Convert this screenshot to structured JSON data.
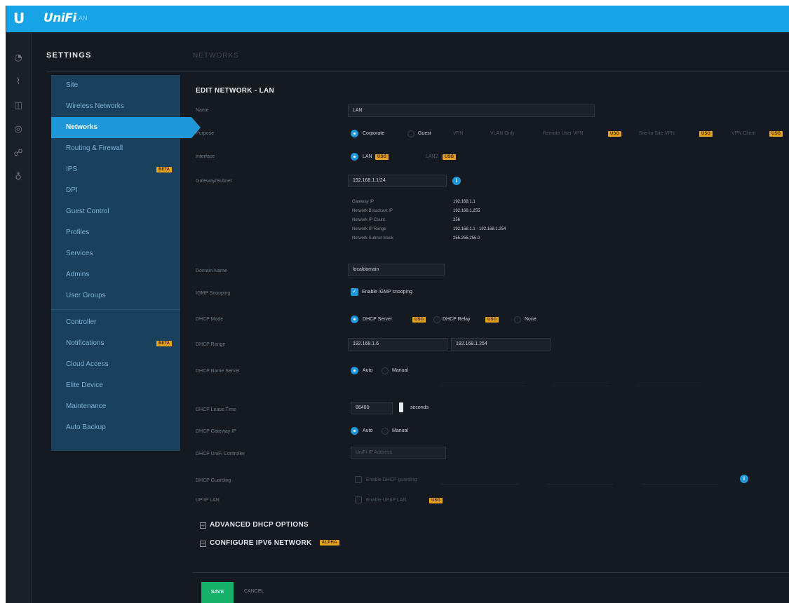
{
  "brand": {
    "logo": "U",
    "name": "UniFi",
    "site": "LAN"
  },
  "rail": {
    "icons": [
      "dashboard-icon",
      "statistics-icon",
      "map-icon",
      "devices-icon",
      "clients-icon",
      "insights-icon"
    ]
  },
  "header": {
    "title": "SETTINGS",
    "crumb": "NETWORKS"
  },
  "sidebar": {
    "items": [
      {
        "label": "Site"
      },
      {
        "label": "Wireless Networks"
      },
      {
        "label": "Networks"
      },
      {
        "label": "Routing & Firewall"
      },
      {
        "label": "IPS",
        "badge": "BETA"
      },
      {
        "label": "DPI"
      },
      {
        "label": "Guest Control"
      },
      {
        "label": "Profiles"
      },
      {
        "label": "Services"
      },
      {
        "label": "Admins"
      },
      {
        "label": "User Groups"
      },
      {
        "label": "Controller"
      },
      {
        "label": "Notifications",
        "badge": "BETA"
      },
      {
        "label": "Cloud Access"
      },
      {
        "label": "Elite Device"
      },
      {
        "label": "Maintenance"
      },
      {
        "label": "Auto Backup"
      }
    ],
    "active_index": 2
  },
  "form": {
    "title": "EDIT NETWORK - LAN",
    "name": {
      "label": "Name",
      "value": "LAN"
    },
    "purpose": {
      "label": "Purpose",
      "options": [
        "Corporate",
        "Guest",
        "VPN",
        "VLAN Only",
        "Remote User VPN",
        "Site-to-Site VPN",
        "VPN Client"
      ],
      "selected": "Corporate",
      "badge": "USG"
    },
    "interface": {
      "label": "Interface",
      "options": [
        "LAN",
        "LAN2"
      ],
      "selected": "LAN",
      "badge": "USG"
    },
    "gateway": {
      "label": "Gateway/Subnet",
      "value": "192.168.1.1/24",
      "details": [
        {
          "key": "Gateway IP",
          "value": "192.168.1.1"
        },
        {
          "key": "Network Broadcast IP",
          "value": "192.168.1.255"
        },
        {
          "key": "Network IP Count",
          "value": "256"
        },
        {
          "key": "Network IP Range",
          "value": "192.168.1.1 - 192.168.1.254"
        },
        {
          "key": "Network Subnet Mask",
          "value": "255.255.255.0"
        }
      ]
    },
    "domain": {
      "label": "Domain Name",
      "value": "localdomain"
    },
    "igmp": {
      "label": "IGMP Snooping",
      "checkbox": "Enable IGMP snooping",
      "checked": true
    },
    "dhcp_mode": {
      "label": "DHCP Mode",
      "options": [
        "DHCP Server",
        "DHCP Relay",
        "None"
      ],
      "selected": "DHCP Server",
      "badge": "USG"
    },
    "dhcp_range": {
      "label": "DHCP Range",
      "start": "192.168.1.6",
      "end": "192.168.1.254"
    },
    "dhcp_ns": {
      "label": "DHCP Name Server",
      "options": [
        "Auto",
        "Manual"
      ],
      "selected": "Auto"
    },
    "lease": {
      "label": "DHCP Lease Time",
      "value": "86400",
      "unit": "seconds"
    },
    "dhcp_gateway": {
      "label": "DHCP Gateway IP",
      "options": [
        "Auto",
        "Manual"
      ],
      "selected": "Auto"
    },
    "unifi_controller": {
      "label": "DHCP UniFi Controller",
      "placeholder": "UniFi IP Address"
    },
    "guarding": {
      "label": "DHCP Guarding",
      "checkbox": "Enable DHCP guarding",
      "checked": false
    },
    "upnp": {
      "label": "UPnP LAN",
      "checkbox": "Enable UPnP LAN",
      "checked": false,
      "badge": "USG"
    },
    "advanced_dhcp": "ADVANCED DHCP OPTIONS",
    "ipv6": {
      "label": "CONFIGURE IPV6 NETWORK",
      "badge": "ALPHA"
    }
  },
  "actions": {
    "save": "SAVE",
    "cancel": "CANCEL"
  },
  "colors": {
    "accent": "#1f97d9",
    "topbar": "#17a3e6",
    "save": "#17b06a",
    "badge": "#e8a31c",
    "sidebar": "#19405c"
  }
}
